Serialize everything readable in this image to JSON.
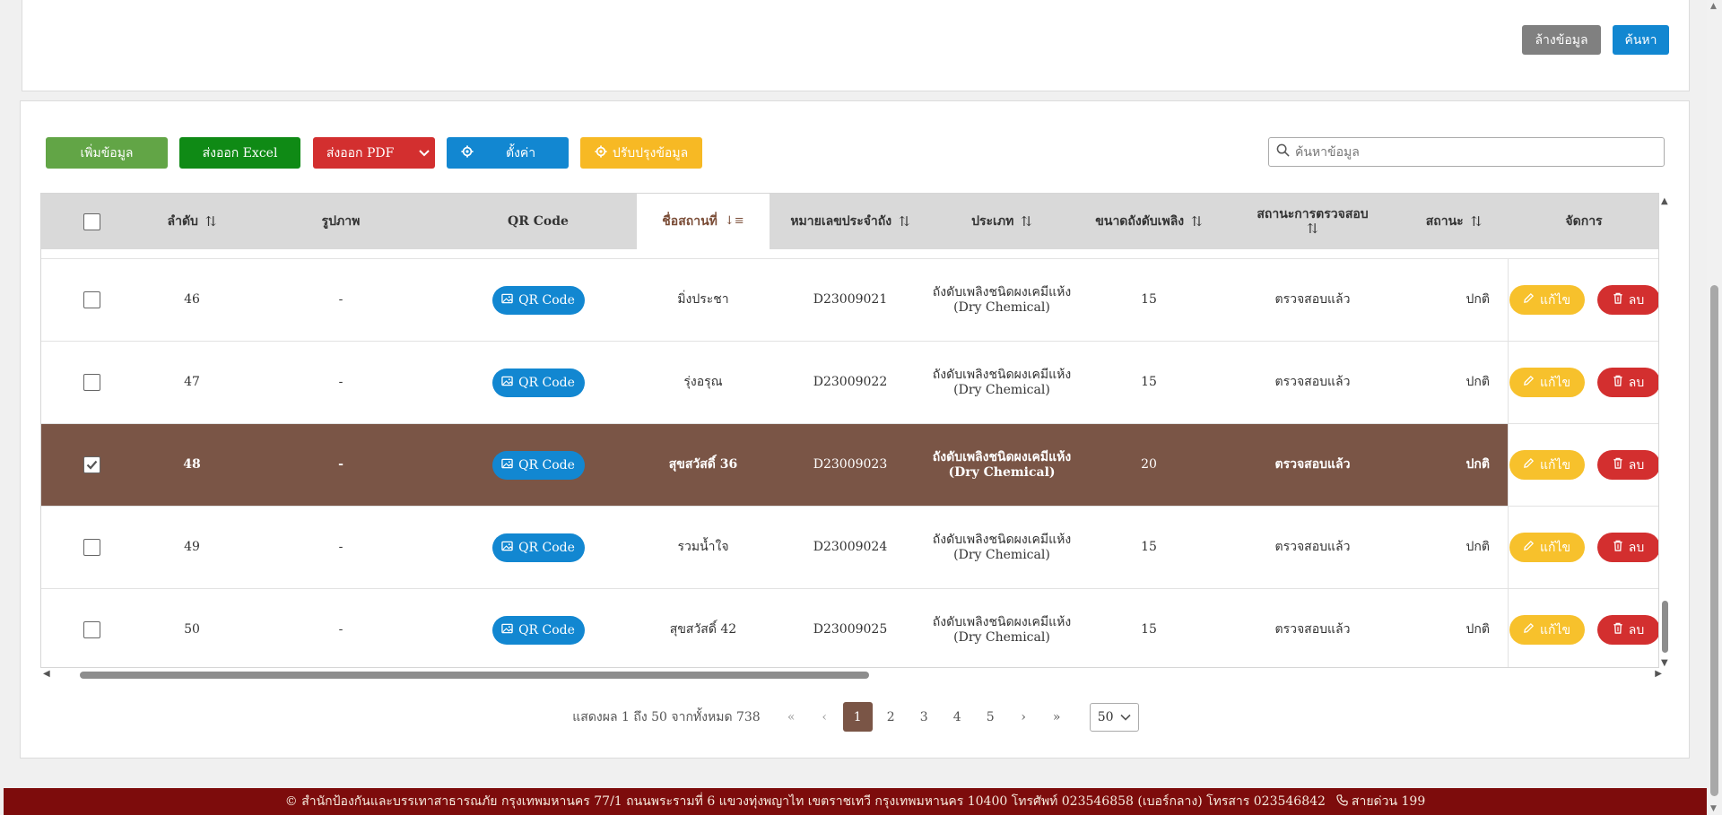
{
  "search_panel": {
    "clear_label": "ล้างข้อมูล",
    "search_label": "ค้นหา"
  },
  "toolbar": {
    "add_label": "เพิ่มข้อมูล",
    "excel_label": "ส่งออก Excel",
    "pdf_label": "ส่งออก PDF",
    "settings_label": "ตั้งค่า",
    "update_label": "ปรับปรุงข้อมูล",
    "search_placeholder": "ค้นหาข้อมูล"
  },
  "table": {
    "headers": {
      "order": "ลำดับ",
      "image": "รูปภาพ",
      "qr": "QR Code",
      "place": "ชื่อสถานที่",
      "tank_no": "หมายเลขประจำถัง",
      "type": "ประเภท",
      "size": "ขนาดถังดับเพลิง",
      "inspection_l1": "สถานะการตรวจสอบ",
      "status": "สถานะ",
      "manage": "จัดการ"
    },
    "sort_icon": "⇅",
    "sorted_icon": "↓≡",
    "qr_label": "QR Code",
    "edit_label": "แก้ไข",
    "delete_label": "ลบ",
    "rows": [
      {
        "order": "46",
        "image": "-",
        "place": "มิ่งประชา",
        "tank_no": "D23009021",
        "type": "ถังดับเพลิงชนิดผงเคมีแห้ง (Dry Chemical)",
        "size": "15",
        "inspection": "ตรวจสอบแล้ว",
        "status": "ปกติ",
        "checked": false
      },
      {
        "order": "47",
        "image": "-",
        "place": "รุ่งอรุณ",
        "tank_no": "D23009022",
        "type": "ถังดับเพลิงชนิดผงเคมีแห้ง (Dry Chemical)",
        "size": "15",
        "inspection": "ตรวจสอบแล้ว",
        "status": "ปกติ",
        "checked": false
      },
      {
        "order": "48",
        "image": "-",
        "place": "สุขสวัสดิ์ 36",
        "tank_no": "D23009023",
        "type": "ถังดับเพลิงชนิดผงเคมีแห้ง (Dry Chemical)",
        "size": "20",
        "inspection": "ตรวจสอบแล้ว",
        "status": "ปกติ",
        "checked": true
      },
      {
        "order": "49",
        "image": "-",
        "place": "รวมน้ำใจ",
        "tank_no": "D23009024",
        "type": "ถังดับเพลิงชนิดผงเคมีแห้ง (Dry Chemical)",
        "size": "15",
        "inspection": "ตรวจสอบแล้ว",
        "status": "ปกติ",
        "checked": false
      },
      {
        "order": "50",
        "image": "-",
        "place": "สุขสวัสดิ์ 42",
        "tank_no": "D23009025",
        "type": "ถังดับเพลิงชนิดผงเคมีแห้ง (Dry Chemical)",
        "size": "15",
        "inspection": "ตรวจสอบแล้ว",
        "status": "ปกติ",
        "checked": false
      }
    ]
  },
  "pagination": {
    "info": "แสดงผล 1 ถึง 50 จากทั้งหมด 738",
    "first": "«",
    "prev": "‹",
    "pages": [
      "1",
      "2",
      "3",
      "4",
      "5"
    ],
    "active_page": "1",
    "next": "›",
    "last": "»",
    "page_size": "50"
  },
  "footer": {
    "text": "© สำนักป้องกันและบรรเทาสาธารณภัย กรุงเทพมหานคร 77/1 ถนนพระรามที่ 6 แขวงทุ่งพญาไท เขตราชเทวี กรุงเทพมหานคร 10400 โทรศัพท์ 023546858 (เบอร์กลาง) โทรสาร 023546842",
    "hotline": "สายด่วน 199"
  },
  "colors": {
    "primary": "#1287d1",
    "add": "#62a546",
    "excel": "#0f8a15",
    "danger": "#d32f2f",
    "warning": "#f7b924",
    "selected_row": "#7a5546",
    "footer": "#7d0c0c"
  }
}
